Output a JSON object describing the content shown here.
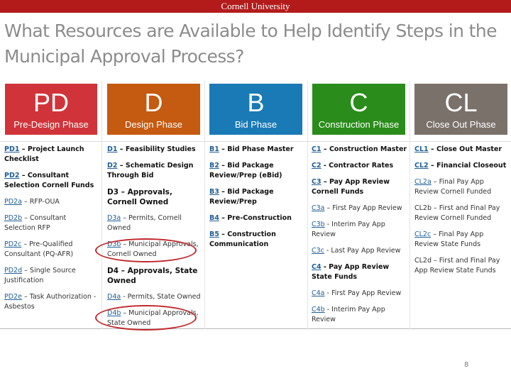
{
  "header": {
    "institution": "Cornell University"
  },
  "slide": {
    "title": "What Resources are Available to Help Identify Steps in the Municipal Approval Process?",
    "page_number": "8"
  },
  "colors": {
    "header_bar": "#b31b1b",
    "title_text": "#8c8c8c",
    "link": "#1f5e96",
    "highlight_oval": "#c0282c"
  },
  "phases": [
    {
      "abbr": "PD",
      "name": "Pre-Design Phase",
      "color": "#d0343a",
      "items": [
        {
          "code": "PD1",
          "text": " – Project Launch Checklist",
          "bold": true,
          "link": true
        },
        {
          "code": "PD2",
          "text": " – Consultant Selection Cornell Funds",
          "bold": true,
          "link": true
        },
        {
          "code": "PD2a",
          "text": " – RFP-OUA",
          "bold": false,
          "link": true
        },
        {
          "code": "PD2b",
          "text": " – Consultant Selection RFP",
          "bold": false,
          "link": true
        },
        {
          "code": "PD2c",
          "text": " – Pre-Qualified Consultant (PQ-AFR)",
          "bold": false,
          "link": true
        },
        {
          "code": "PD2d",
          "text": " – Single Source Justification",
          "bold": false,
          "link": true
        },
        {
          "code": "PD2e",
          "text": " – Task Authorization - Asbestos",
          "bold": false,
          "link": true
        }
      ]
    },
    {
      "abbr": "D",
      "name": "Design Phase",
      "color": "#c55a11",
      "items": [
        {
          "code": "D1",
          "text": " – Feasibility Studies",
          "bold": true,
          "link": true
        },
        {
          "code": "D2",
          "text": " – Schematic Design Through Bid",
          "bold": true,
          "link": true
        },
        {
          "code": "D3",
          "text": " – Approvals, Cornell Owned",
          "bold": true,
          "link": false
        },
        {
          "code": "D3a",
          "text": " – Permits, Cornell Owned",
          "bold": false,
          "link": true
        },
        {
          "code": "D3b",
          "text": " – Municipal Approvals, Cornell Owned",
          "bold": false,
          "link": true,
          "highlighted": true
        },
        {
          "code": "D4",
          "text": " – Approvals, State Owned",
          "bold": true,
          "link": false
        },
        {
          "code": "D4a",
          "text": " - Permits, State Owned",
          "bold": false,
          "link": true
        },
        {
          "code": "D4b",
          "text": " – Municipal Approvals, State Owned",
          "bold": false,
          "link": true,
          "highlighted": true
        }
      ]
    },
    {
      "abbr": "B",
      "name": "Bid Phase",
      "color": "#1a7ab5",
      "items": [
        {
          "code": "B1",
          "text": " – Bid Phase Master",
          "bold": true,
          "link": true
        },
        {
          "code": "B2",
          "text": " – Bid Package Review/Prep (eBid)",
          "bold": true,
          "link": true
        },
        {
          "code": "B3",
          "text": " – Bid Package Review/Prep",
          "bold": true,
          "link": true
        },
        {
          "code": "B4",
          "text": " – Pre-Construction",
          "bold": true,
          "link": true
        },
        {
          "code": "B5",
          "text": " – Construction Communication",
          "bold": true,
          "link": true
        }
      ]
    },
    {
      "abbr": "C",
      "name": "Construction Phase",
      "color": "#2a8c1a",
      "items": [
        {
          "code": "C1",
          "text": " – Construction Master",
          "bold": true,
          "link": true
        },
        {
          "code": "C2",
          "text": " - Contractor Rates",
          "bold": true,
          "link": true
        },
        {
          "code": "C3",
          "text": " – Pay App Review Cornell Funds",
          "bold": true,
          "link": true
        },
        {
          "code": "C3a",
          "text": " – First Pay App Review",
          "bold": false,
          "link": true
        },
        {
          "code": "C3b",
          "text": " - Interim Pay App Review",
          "bold": false,
          "link": true
        },
        {
          "code": "C3c",
          "text": " - Last Pay App Review",
          "bold": false,
          "link": true
        },
        {
          "code": "C4",
          "text": " - Pay App Review State Funds",
          "bold": true,
          "link": true
        },
        {
          "code": "C4a",
          "text": " - First Pay App Review",
          "bold": false,
          "link": true
        },
        {
          "code": "C4b",
          "text": " - Interim Pay App Review",
          "bold": false,
          "link": true
        }
      ]
    },
    {
      "abbr": "CL",
      "name": "Close Out Phase",
      "color": "#7a716b",
      "items": [
        {
          "code": "CL1",
          "text": " – Close Out Master",
          "bold": true,
          "link": true
        },
        {
          "code": "CL2",
          "text": " – Financial Closeout",
          "bold": true,
          "link": true
        },
        {
          "code": "CL2a",
          "text": " – Final Pay App Review Cornell Funded",
          "bold": false,
          "link": true
        },
        {
          "code": "CL2b",
          "text": " – First and Final Pay Review Cornell Funded",
          "bold": false,
          "link": false
        },
        {
          "code": "CL2c",
          "text": " – Final Pay App Review State Funds",
          "bold": false,
          "link": true
        },
        {
          "code": "CL2d",
          "text": " – First and Final Pay App Review State Funds",
          "bold": false,
          "link": false
        }
      ]
    }
  ]
}
